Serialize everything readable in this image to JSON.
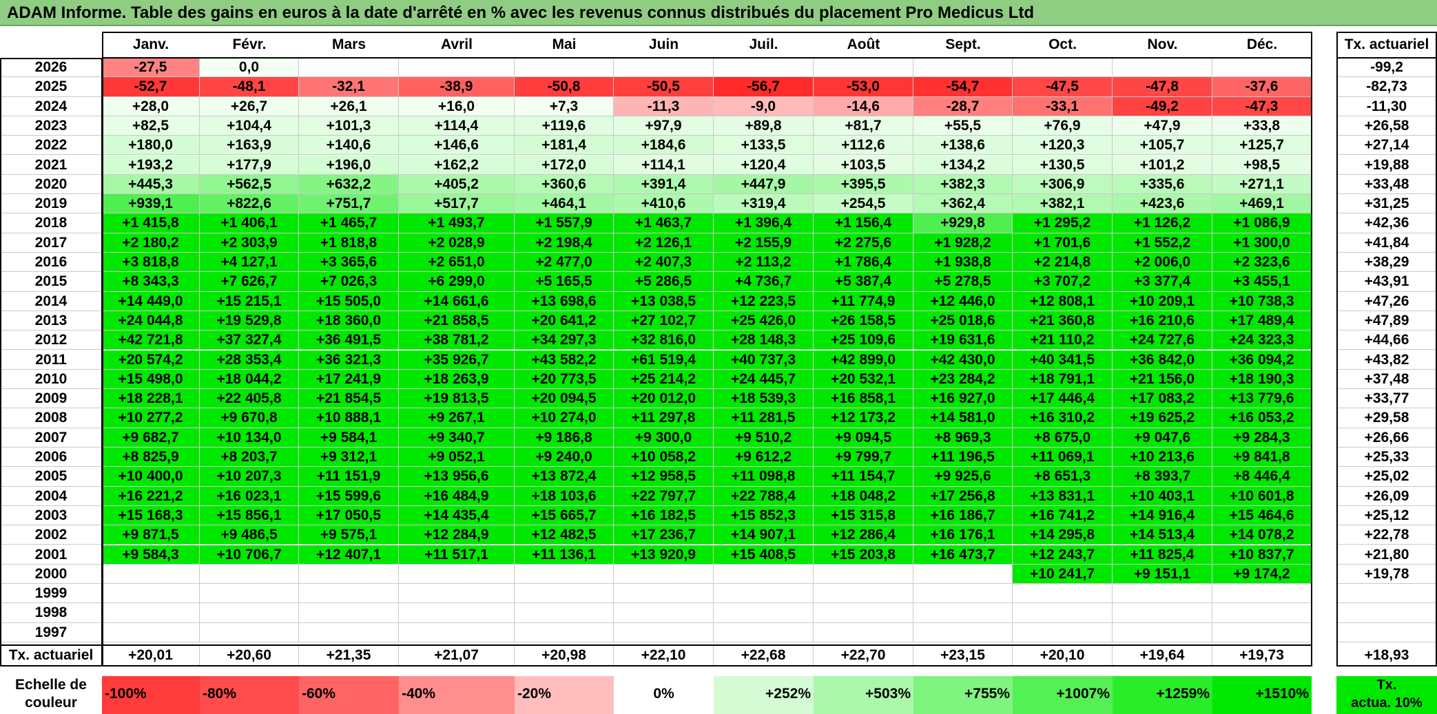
{
  "title": "ADAM Informe. Table des gains en euros à la date d'arrêté en % avec les revenus connus distribués du placement Pro Medicus Ltd",
  "months": [
    "Janv.",
    "Févr.",
    "Mars",
    "Avril",
    "Mai",
    "Juin",
    "Juil.",
    "Août",
    "Sept.",
    "Oct.",
    "Nov.",
    "Déc."
  ],
  "annual_rate_header": "Tx. actuariel",
  "rows": [
    {
      "year": "2026",
      "values": [
        "-27,5",
        "0,0",
        "",
        "",
        "",
        "",
        "",
        "",
        "",
        "",
        "",
        ""
      ],
      "rate": "-99,2"
    },
    {
      "year": "2025",
      "values": [
        "-52,7",
        "-48,1",
        "-32,1",
        "-38,9",
        "-50,8",
        "-50,5",
        "-56,7",
        "-53,0",
        "-54,7",
        "-47,5",
        "-47,8",
        "-37,6"
      ],
      "rate": "-82,73"
    },
    {
      "year": "2024",
      "values": [
        "+28,0",
        "+26,7",
        "+26,1",
        "+16,0",
        "+7,3",
        "-11,3",
        "-9,0",
        "-14,6",
        "-28,7",
        "-33,1",
        "-49,2",
        "-47,3"
      ],
      "rate": "-11,30"
    },
    {
      "year": "2023",
      "values": [
        "+82,5",
        "+104,4",
        "+101,3",
        "+114,4",
        "+119,6",
        "+97,9",
        "+89,8",
        "+81,7",
        "+55,5",
        "+76,9",
        "+47,9",
        "+33,8"
      ],
      "rate": "+26,58"
    },
    {
      "year": "2022",
      "values": [
        "+180,0",
        "+163,9",
        "+140,6",
        "+146,6",
        "+181,4",
        "+184,6",
        "+133,5",
        "+112,6",
        "+138,6",
        "+120,3",
        "+105,7",
        "+125,7"
      ],
      "rate": "+27,14"
    },
    {
      "year": "2021",
      "values": [
        "+193,2",
        "+177,9",
        "+196,0",
        "+162,2",
        "+172,0",
        "+114,1",
        "+120,4",
        "+103,5",
        "+134,2",
        "+130,5",
        "+101,2",
        "+98,5"
      ],
      "rate": "+19,88"
    },
    {
      "year": "2020",
      "values": [
        "+445,3",
        "+562,5",
        "+632,2",
        "+405,2",
        "+360,6",
        "+391,4",
        "+447,9",
        "+395,5",
        "+382,3",
        "+306,9",
        "+335,6",
        "+271,1"
      ],
      "rate": "+33,48"
    },
    {
      "year": "2019",
      "values": [
        "+939,1",
        "+822,6",
        "+751,7",
        "+517,7",
        "+464,1",
        "+410,6",
        "+319,4",
        "+254,5",
        "+362,4",
        "+382,1",
        "+423,6",
        "+469,1"
      ],
      "rate": "+31,25"
    },
    {
      "year": "2018",
      "values": [
        "+1 415,8",
        "+1 406,1",
        "+1 465,7",
        "+1 493,7",
        "+1 557,9",
        "+1 463,7",
        "+1 396,4",
        "+1 156,4",
        "+929,8",
        "+1 295,2",
        "+1 126,2",
        "+1 086,9"
      ],
      "rate": "+42,36"
    },
    {
      "year": "2017",
      "values": [
        "+2 180,2",
        "+2 303,9",
        "+1 818,8",
        "+2 028,9",
        "+2 198,4",
        "+2 126,1",
        "+2 155,9",
        "+2 275,6",
        "+1 928,2",
        "+1 701,6",
        "+1 552,2",
        "+1 300,0"
      ],
      "rate": "+41,84"
    },
    {
      "year": "2016",
      "values": [
        "+3 818,8",
        "+4 127,1",
        "+3 365,6",
        "+2 651,0",
        "+2 477,0",
        "+2 407,3",
        "+2 113,2",
        "+1 786,4",
        "+1 938,8",
        "+2 214,8",
        "+2 006,0",
        "+2 323,6"
      ],
      "rate": "+38,29"
    },
    {
      "year": "2015",
      "values": [
        "+8 343,3",
        "+7 626,7",
        "+7 026,3",
        "+6 299,0",
        "+5 165,5",
        "+5 286,5",
        "+4 736,7",
        "+5 387,4",
        "+5 278,5",
        "+3 707,2",
        "+3 377,4",
        "+3 455,1"
      ],
      "rate": "+43,91"
    },
    {
      "year": "2014",
      "values": [
        "+14 449,0",
        "+15 215,1",
        "+15 505,0",
        "+14 661,6",
        "+13 698,6",
        "+13 038,5",
        "+12 223,5",
        "+11 774,9",
        "+12 446,0",
        "+12 808,1",
        "+10 209,1",
        "+10 738,3"
      ],
      "rate": "+47,26"
    },
    {
      "year": "2013",
      "values": [
        "+24 044,8",
        "+19 529,8",
        "+18 360,0",
        "+21 858,5",
        "+20 641,2",
        "+27 102,7",
        "+25 426,0",
        "+26 158,5",
        "+25 018,6",
        "+21 360,8",
        "+16 210,6",
        "+17 489,4"
      ],
      "rate": "+47,89"
    },
    {
      "year": "2012",
      "values": [
        "+42 721,8",
        "+37 327,4",
        "+36 491,5",
        "+38 781,2",
        "+34 297,3",
        "+32 816,0",
        "+28 148,3",
        "+25 109,6",
        "+19 631,6",
        "+21 110,2",
        "+24 727,6",
        "+24 323,3"
      ],
      "rate": "+44,66"
    },
    {
      "year": "2011",
      "values": [
        "+20 574,2",
        "+28 353,4",
        "+36 321,3",
        "+35 926,7",
        "+43 582,2",
        "+61 519,4",
        "+40 737,3",
        "+42 899,0",
        "+42 430,0",
        "+40 341,5",
        "+36 842,0",
        "+36 094,2"
      ],
      "rate": "+43,82"
    },
    {
      "year": "2010",
      "values": [
        "+15 498,0",
        "+18 044,2",
        "+17 241,9",
        "+18 263,9",
        "+20 773,5",
        "+25 214,2",
        "+24 445,7",
        "+20 532,1",
        "+23 284,2",
        "+18 791,1",
        "+21 156,0",
        "+18 190,3"
      ],
      "rate": "+37,48"
    },
    {
      "year": "2009",
      "values": [
        "+18 228,1",
        "+22 405,8",
        "+21 854,5",
        "+19 813,5",
        "+20 094,5",
        "+20 012,0",
        "+18 539,3",
        "+16 858,1",
        "+16 927,0",
        "+17 446,4",
        "+17 083,2",
        "+13 779,6"
      ],
      "rate": "+33,77"
    },
    {
      "year": "2008",
      "values": [
        "+10 277,2",
        "+9 670,8",
        "+10 888,1",
        "+9 267,1",
        "+10 274,0",
        "+11 297,8",
        "+11 281,5",
        "+12 173,2",
        "+14 581,0",
        "+16 310,2",
        "+19 625,2",
        "+16 053,2"
      ],
      "rate": "+29,58"
    },
    {
      "year": "2007",
      "values": [
        "+9 682,7",
        "+10 134,0",
        "+9 584,1",
        "+9 340,7",
        "+9 186,8",
        "+9 300,0",
        "+9 510,2",
        "+9 094,5",
        "+8 969,3",
        "+8 675,0",
        "+9 047,6",
        "+9 284,3"
      ],
      "rate": "+26,66"
    },
    {
      "year": "2006",
      "values": [
        "+8 825,9",
        "+8 203,7",
        "+9 312,1",
        "+9 052,1",
        "+9 240,0",
        "+10 058,2",
        "+9 612,2",
        "+9 799,7",
        "+11 196,5",
        "+11 069,1",
        "+10 213,6",
        "+9 841,8"
      ],
      "rate": "+25,33"
    },
    {
      "year": "2005",
      "values": [
        "+10 400,0",
        "+10 207,3",
        "+11 151,9",
        "+13 956,6",
        "+13 872,4",
        "+12 958,5",
        "+11 098,8",
        "+11 154,7",
        "+9 925,6",
        "+8 651,3",
        "+8 393,7",
        "+8 446,4"
      ],
      "rate": "+25,02"
    },
    {
      "year": "2004",
      "values": [
        "+16 221,2",
        "+16 023,1",
        "+15 599,6",
        "+16 484,9",
        "+18 103,6",
        "+22 797,7",
        "+22 788,4",
        "+18 048,2",
        "+17 256,8",
        "+13 831,1",
        "+10 403,1",
        "+10 601,8"
      ],
      "rate": "+26,09"
    },
    {
      "year": "2003",
      "values": [
        "+15 168,3",
        "+15 856,1",
        "+17 050,5",
        "+14 435,4",
        "+15 665,7",
        "+16 182,5",
        "+15 852,3",
        "+15 315,8",
        "+16 186,7",
        "+16 741,2",
        "+14 916,4",
        "+15 464,6"
      ],
      "rate": "+25,12"
    },
    {
      "year": "2002",
      "values": [
        "+9 871,5",
        "+9 486,5",
        "+9 575,1",
        "+12 284,9",
        "+12 482,5",
        "+17 236,7",
        "+14 907,1",
        "+12 286,4",
        "+16 176,1",
        "+14 295,8",
        "+14 513,4",
        "+14 078,2"
      ],
      "rate": "+22,78"
    },
    {
      "year": "2001",
      "values": [
        "+9 584,3",
        "+10 706,7",
        "+12 407,1",
        "+11 517,1",
        "+11 136,1",
        "+13 920,9",
        "+15 408,5",
        "+15 203,8",
        "+16 473,7",
        "+12 243,7",
        "+11 825,4",
        "+10 837,7"
      ],
      "rate": "+21,80"
    },
    {
      "year": "2000",
      "values": [
        "",
        "",
        "",
        "",
        "",
        "",
        "",
        "",
        "",
        "+10 241,7",
        "+9 151,1",
        "+9 174,2"
      ],
      "rate": "+19,78"
    },
    {
      "year": "1999",
      "values": [
        "",
        "",
        "",
        "",
        "",
        "",
        "",
        "",
        "",
        "",
        "",
        ""
      ],
      "rate": ""
    },
    {
      "year": "1998",
      "values": [
        "",
        "",
        "",
        "",
        "",
        "",
        "",
        "",
        "",
        "",
        "",
        ""
      ],
      "rate": ""
    },
    {
      "year": "1997",
      "values": [
        "",
        "",
        "",
        "",
        "",
        "",
        "",
        "",
        "",
        "",
        "",
        ""
      ],
      "rate": ""
    }
  ],
  "footer": {
    "label": "Tx. actuariel",
    "values": [
      "+20,01",
      "+20,60",
      "+21,35",
      "+21,07",
      "+20,98",
      "+22,10",
      "+22,68",
      "+22,70",
      "+23,15",
      "+20,10",
      "+19,64",
      "+19,73"
    ],
    "total": "+18,93"
  },
  "legend": {
    "label_line1": "Echelle de",
    "label_line2": "couleur",
    "steps": [
      {
        "text": "-100%",
        "color": "#ff3b3b",
        "align": "left"
      },
      {
        "text": "-80%",
        "color": "#ff4d4d",
        "align": "left"
      },
      {
        "text": "-60%",
        "color": "#ff6464",
        "align": "left"
      },
      {
        "text": "-40%",
        "color": "#ff8e8e",
        "align": "left"
      },
      {
        "text": "-20%",
        "color": "#ffbdbd",
        "align": "left"
      },
      {
        "text": "0%",
        "color": "#ffffff",
        "align": "center"
      },
      {
        "text": "+252%",
        "color": "#d4fbd4",
        "align": "right"
      },
      {
        "text": "+503%",
        "color": "#abf7ab",
        "align": "right"
      },
      {
        "text": "+755%",
        "color": "#7ff47f",
        "align": "right"
      },
      {
        "text": "+1007%",
        "color": "#55f055",
        "align": "right"
      },
      {
        "text": "+1259%",
        "color": "#2aed2a",
        "align": "right"
      },
      {
        "text": "+1510%",
        "color": "#00e800",
        "align": "right"
      }
    ],
    "rate_box_line1": "Tx.",
    "rate_box_line2": "actua. 10%",
    "rate_box_color": "#00e800"
  },
  "colors": {
    "title_bar": "#8fcd82",
    "neg_scale_base": "#ffffff",
    "neg_scale_end": "#ff2a2a",
    "pos_scale_end": "#00e800"
  }
}
